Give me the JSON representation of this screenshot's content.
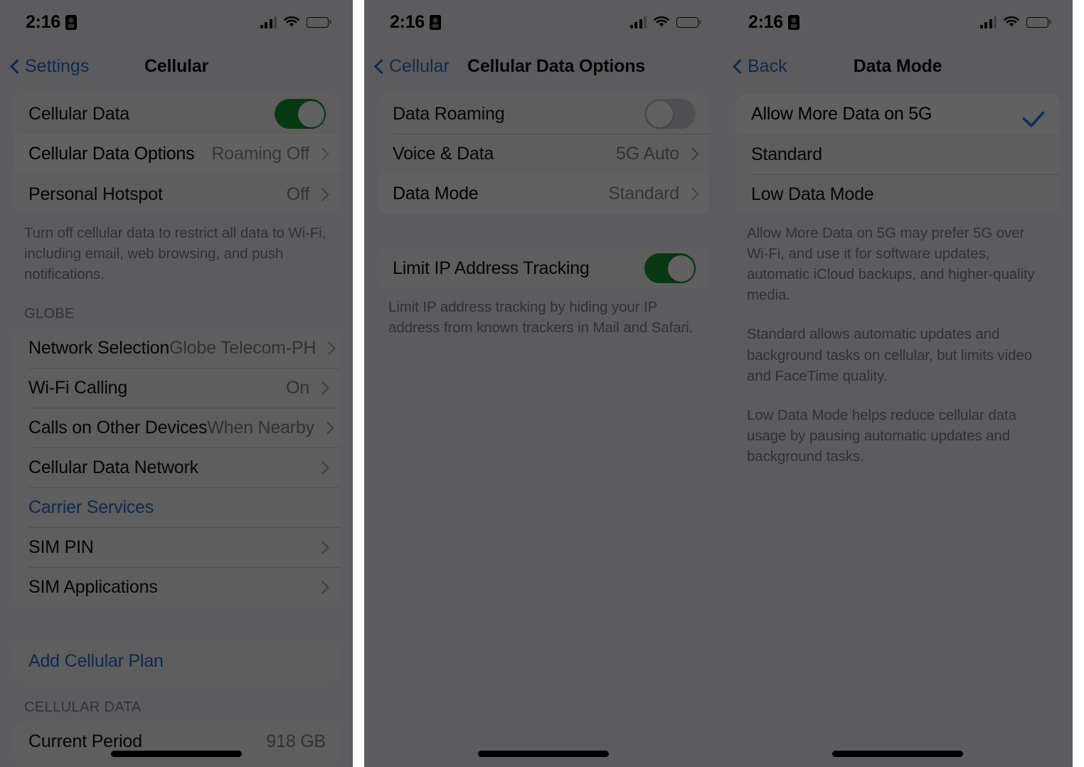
{
  "status_bar": {
    "time": "2:16",
    "record_icon": "screen-record-icon",
    "signal_icon": "cellular-signal-icon",
    "wifi_icon": "wifi-icon",
    "battery_icon": "battery-icon"
  },
  "panel1": {
    "nav": {
      "back_label": "Settings",
      "title": "Cellular"
    },
    "group1": [
      {
        "label": "Cellular Data",
        "value": "",
        "control": "toggle-on"
      },
      {
        "label": "Cellular Data Options",
        "value": "Roaming Off",
        "control": "chevron",
        "highlighted": true
      },
      {
        "label": "Personal Hotspot",
        "value": "Off",
        "control": "chevron"
      }
    ],
    "footnote1": "Turn off cellular data to restrict all data to Wi-Fi, including email, web browsing, and push notifications.",
    "section_globe": "GLOBE",
    "group2": [
      {
        "label": "Network Selection",
        "value": "Globe Telecom-PH",
        "control": "chevron"
      },
      {
        "label": "Wi-Fi Calling",
        "value": "On",
        "control": "chevron"
      },
      {
        "label": "Calls on Other Devices",
        "value": "When Nearby",
        "control": "chevron"
      },
      {
        "label": "Cellular Data Network",
        "value": "",
        "control": "chevron"
      },
      {
        "label": "Carrier Services",
        "value": "",
        "control": "link"
      },
      {
        "label": "SIM PIN",
        "value": "",
        "control": "chevron"
      },
      {
        "label": "SIM Applications",
        "value": "",
        "control": "chevron"
      }
    ],
    "group3": [
      {
        "label": "Add Cellular Plan",
        "value": "",
        "control": "link"
      }
    ],
    "section_cellular_data": "CELLULAR DATA",
    "group4": [
      {
        "label": "Current Period",
        "value": "918 GB",
        "control": "none"
      }
    ]
  },
  "panel2": {
    "nav": {
      "back_label": "Cellular",
      "title": "Cellular Data Options"
    },
    "group1": [
      {
        "label": "Data Roaming",
        "value": "",
        "control": "toggle-off"
      },
      {
        "label": "Voice & Data",
        "value": "5G Auto",
        "control": "chevron"
      },
      {
        "label": "Data Mode",
        "value": "Standard",
        "control": "chevron",
        "highlighted": true
      }
    ],
    "group2": [
      {
        "label": "Limit IP Address Tracking",
        "value": "",
        "control": "toggle-on"
      }
    ],
    "footnote": "Limit IP address tracking by hiding your IP address from known trackers in Mail and Safari."
  },
  "panel3": {
    "nav": {
      "back_label": "Back",
      "title": "Data Mode"
    },
    "options": [
      {
        "label": "Allow More Data on 5G",
        "selected": true,
        "highlighted": true
      },
      {
        "label": "Standard",
        "selected": false
      },
      {
        "label": "Low Data Mode",
        "selected": false
      }
    ],
    "footnotes": [
      "Allow More Data on 5G may prefer 5G over Wi-Fi, and use it for software updates, automatic iCloud backups, and higher-quality media.",
      "Standard allows automatic updates and background tasks on cellular, but limits video and FaceTime quality.",
      "Low Data Mode helps reduce cellular data usage by pausing automatic updates and background tasks."
    ]
  },
  "colors": {
    "accent_blue": "#2b6fd1",
    "toggle_green": "#149a2d",
    "check_blue": "#2f7de1",
    "page_background": "#f2f2f7"
  }
}
